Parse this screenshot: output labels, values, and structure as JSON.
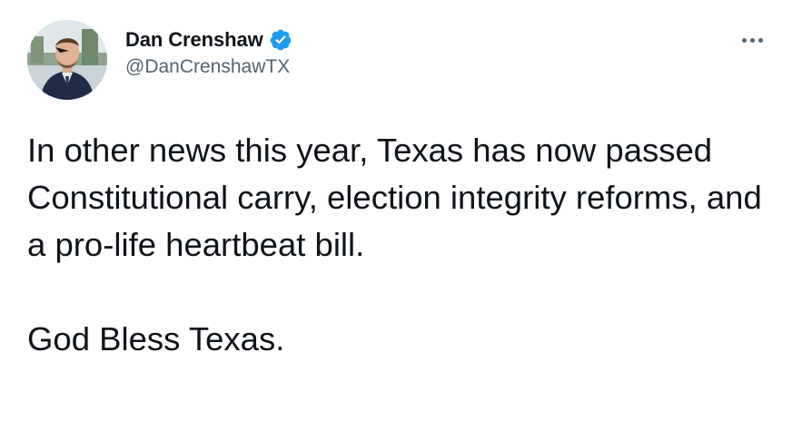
{
  "author": {
    "display_name": "Dan Crenshaw",
    "handle": "@DanCrenshawTX",
    "verified": true
  },
  "tweet": {
    "paragraph_1": "In other news this year, Texas has now passed Constitutional carry, election integrity reforms, and a pro-life heartbeat bill.",
    "paragraph_2": "God Bless Texas."
  },
  "icons": {
    "verified": "verified-badge-icon",
    "more": "more-options-icon"
  },
  "colors": {
    "verified_blue": "#1d9bf0",
    "secondary_text": "#536471",
    "primary_text": "#0f1419"
  }
}
